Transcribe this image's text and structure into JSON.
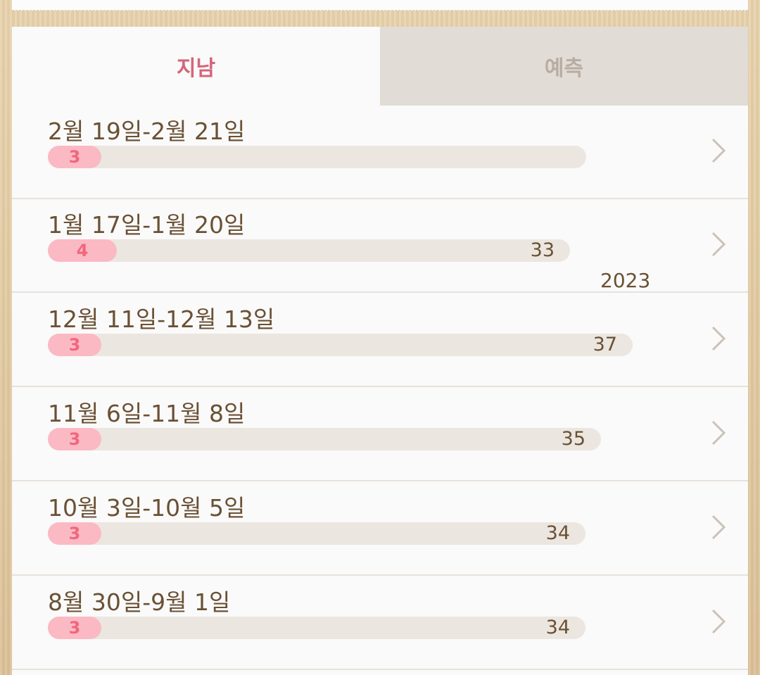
{
  "tabs": {
    "past_label": "지남",
    "prediction_label": "예측"
  },
  "year_separator": "2023",
  "rows": [
    {
      "label": "2월 19일-2월 21일",
      "period_days": "3",
      "cycle_days": ""
    },
    {
      "label": "1월 17일-1월 20일",
      "period_days": "4",
      "cycle_days": "33"
    },
    {
      "label": "12월 11일-12월 13일",
      "period_days": "3",
      "cycle_days": "37"
    },
    {
      "label": "11월 6일-11월 8일",
      "period_days": "3",
      "cycle_days": "35"
    },
    {
      "label": "10월 3일-10월 5일",
      "period_days": "3",
      "cycle_days": "34"
    },
    {
      "label": "8월 30일-9월 1일",
      "period_days": "3",
      "cycle_days": "34"
    }
  ],
  "colors": {
    "active_tab": "#d5657a",
    "inactive_tab": "#b8ada3",
    "pill_bg": "#fbb9c4",
    "pill_text": "#f0677e",
    "text": "#6a5134"
  }
}
